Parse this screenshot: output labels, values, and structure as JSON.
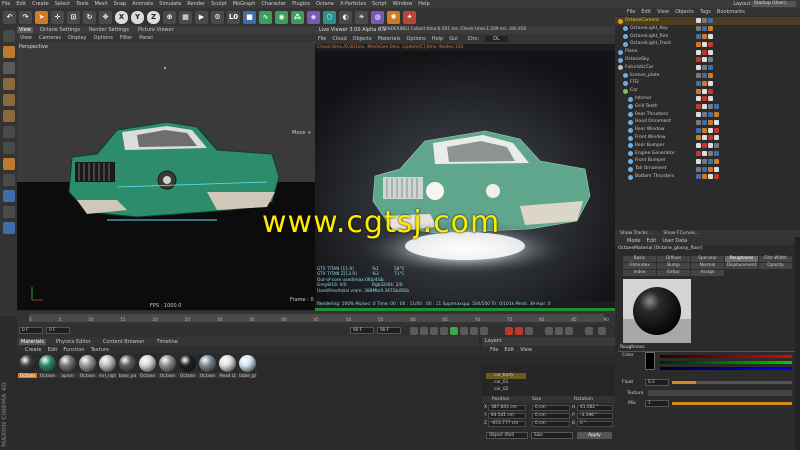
{
  "menubar": {
    "items": [
      "File",
      "Edit",
      "Create",
      "Select",
      "Tools",
      "Mesh",
      "Snap",
      "Animate",
      "Simulate",
      "Render",
      "Sculpt",
      "MoGraph",
      "Character",
      "Plugins",
      "Octane",
      "X-Particles",
      "Script",
      "Window",
      "Help"
    ],
    "layout_label": "Layout:",
    "layout_value": "Startup (User)"
  },
  "toolbar": {
    "axis_x": "X",
    "axis_y": "Y",
    "axis_z": "Z",
    "coord_l": "L0"
  },
  "viewport1": {
    "tabs": [
      "View",
      "Octane Settings",
      "Render Settings",
      "Picture Viewer"
    ],
    "menu": [
      "View",
      "Cameras",
      "Display",
      "Options",
      "Filter",
      "Panel"
    ],
    "camera_label": "Perspective",
    "fps_label": "FPS : 1000.0",
    "frame_label": "Frame : 0",
    "move_label": "Move ✛"
  },
  "viewport2": {
    "title": "Live Viewer 3.00 Alpha 6.1",
    "menu": [
      "File",
      "Cloud",
      "Objects",
      "Materials",
      "Options",
      "Help",
      "Gui"
    ],
    "status_render": "[RENDERING]  Collect time:0.501 ms.  Check time:1.209 ms.  chk:450",
    "chn_label": "Chn:",
    "chn_value": "DL",
    "status_line": "Check:0ms./0.001ms. MeshGen:0ms. Update[C]:0ms. Nodes:156",
    "stats": [
      [
        "GTX TITAN [11.9]",
        "%1",
        "58°C"
      ],
      [
        "GTX TITAN Z[13.9]",
        "%2",
        "71°C"
      ],
      [
        "Out-of-core used/max:0Kb/4Gb",
        "",
        ""
      ],
      [
        "Grey8/16: 0/0",
        "Rgb32/64: 2/0",
        ""
      ],
      [
        "Used/free/total vram: 388Mb/4.347Gb/6Gb",
        "",
        ""
      ]
    ],
    "bottom": "Rendering: 100%   Ms/sec: 0   Time: 00 : 00 : 11/00 : 00 : 11   Spp/maxspp: 500/500   Tri: 0/101k   Mesh: 39   Hair: 0"
  },
  "timeline": {
    "ticks": [
      "0",
      "5",
      "10",
      "15",
      "20",
      "25",
      "30",
      "35",
      "40",
      "45",
      "50",
      "55",
      "60",
      "65",
      "70",
      "75",
      "80",
      "85",
      "90"
    ],
    "start_field": "0 F",
    "start_field2": "0 F",
    "end_field": "90 F",
    "end_field2": "90 F"
  },
  "materials": {
    "tabs": [
      "Materials",
      "Physics Editor",
      "Content Browser",
      "Timeline"
    ],
    "menu": [
      "Create",
      "Edit",
      "Function",
      "Texture"
    ],
    "items": [
      {
        "label": "Octane",
        "color": "#3b3b3b",
        "selected": true
      },
      {
        "label": "Octane",
        "color": "#2b8a6a",
        "selected": false
      },
      {
        "label": "apron",
        "color": "#777777",
        "selected": false
      },
      {
        "label": "Octane",
        "color": "#9a9a9a",
        "selected": false
      },
      {
        "label": "mrl_righ",
        "color": "#bdbdbd",
        "selected": false
      },
      {
        "label": "base_pa",
        "color": "#5e5e5e",
        "selected": false
      },
      {
        "label": "Octane",
        "color": "#d8d8d8",
        "selected": false
      },
      {
        "label": "Octane",
        "color": "#8f8f8f",
        "selected": false
      },
      {
        "label": "Octane",
        "color": "#1f1f1f",
        "selected": false
      },
      {
        "label": "Octane",
        "color": "#7f8b95",
        "selected": false
      },
      {
        "label": "Head Lt",
        "color": "#e0e0e0",
        "selected": false
      },
      {
        "label": "table_gl",
        "color": "#cfe6f0",
        "selected": false
      }
    ]
  },
  "layers": {
    "title": "Layers",
    "menu": [
      "File",
      "Edit",
      "View"
    ],
    "rows": [
      "car_body",
      "car_01",
      "car_02"
    ]
  },
  "coordinates": {
    "headers": [
      "Position",
      "Size",
      "Rotation"
    ],
    "rows": [
      {
        "axis": "X",
        "pos": "387.643 cm",
        "size": "0 cm",
        "rot_axis": "H",
        "rot": "41.562 °"
      },
      {
        "axis": "Y",
        "pos": "84.541 cm",
        "size": "0 cm",
        "rot_axis": "P",
        "rot": "-3.196 °"
      },
      {
        "axis": "Z",
        "pos": "-653.777 cm",
        "size": "0 cm",
        "rot_axis": "B",
        "rot": "0 °"
      }
    ],
    "mode_select": "Object (Rel)",
    "size_select": "Size",
    "apply": "Apply"
  },
  "objects": {
    "menu": [
      "File",
      "Edit",
      "View",
      "Objects",
      "Tags",
      "Bookmarks"
    ],
    "rows": [
      {
        "name": "OctaneCamera",
        "indent": 0,
        "color": "#e0a020",
        "highlight": true
      },
      {
        "name": "OctaneLight_Key",
        "indent": 1,
        "color": "#6fb0e0",
        "highlight": false
      },
      {
        "name": "OctaneLight_Rim",
        "indent": 1,
        "color": "#6fb0e0",
        "highlight": false
      },
      {
        "name": "OctaneLight_Front",
        "indent": 1,
        "color": "#6fb0e0",
        "highlight": false
      },
      {
        "name": "Plane",
        "indent": 0,
        "color": "#6fb0e0",
        "highlight": false
      },
      {
        "name": "OctaneSky",
        "indent": 0,
        "color": "#6fb0e0",
        "highlight": false
      },
      {
        "name": "FuturisticCar",
        "indent": 0,
        "color": "#c0c0c0",
        "highlight": false
      },
      {
        "name": "license_plate",
        "indent": 1,
        "color": "#6fb0e0",
        "highlight": false
      },
      {
        "name": "FFD",
        "indent": 1,
        "color": "#6fb0e0",
        "highlight": false
      },
      {
        "name": "Car",
        "indent": 1,
        "color": "#7cc060",
        "highlight": false
      },
      {
        "name": "Interior",
        "indent": 2,
        "color": "#6fb0e0",
        "highlight": false
      },
      {
        "name": "Grill Teeth",
        "indent": 2,
        "color": "#6fb0e0",
        "highlight": false
      },
      {
        "name": "Rear Thrusters",
        "indent": 2,
        "color": "#6fb0e0",
        "highlight": false
      },
      {
        "name": "Hood Ornament",
        "indent": 2,
        "color": "#6fb0e0",
        "highlight": false
      },
      {
        "name": "Rear Window",
        "indent": 2,
        "color": "#6fb0e0",
        "highlight": false
      },
      {
        "name": "Front Window",
        "indent": 2,
        "color": "#6fb0e0",
        "highlight": false
      },
      {
        "name": "Rear Bumper",
        "indent": 2,
        "color": "#6fb0e0",
        "highlight": false
      },
      {
        "name": "Engine Generator",
        "indent": 2,
        "color": "#6fb0e0",
        "highlight": false
      },
      {
        "name": "Front Bumper",
        "indent": 2,
        "color": "#6fb0e0",
        "highlight": false
      },
      {
        "name": "Tail Ornament",
        "indent": 2,
        "color": "#6fb0e0",
        "highlight": false
      },
      {
        "name": "Bottom Thrusters",
        "indent": 2,
        "color": "#6fb0e0",
        "highlight": false
      }
    ],
    "tabs": [
      "Show Tracks ...",
      "Show FCurves..."
    ]
  },
  "attributes": {
    "menu": [
      "Mode",
      "Edit",
      "User Data"
    ],
    "title": "OctaneMaterial [Octane_glossy_floor]",
    "tabs_row1": [
      "Basic",
      "Diffuse",
      "Specular",
      "Roughness",
      "Film Width"
    ],
    "tabs_row2": [
      "Filmindex",
      "Bump",
      "Normal",
      "Displacement",
      "Opacity"
    ],
    "tabs_row3": [
      "Index",
      "Editor",
      "Assign"
    ],
    "active_tab": "Roughness",
    "section": "Roughness",
    "color_label": "Color",
    "float_label": "Float",
    "float_value": "0.2",
    "texture_label": "Texture",
    "mix_label": "Mix",
    "mix_value": "1"
  },
  "watermark": "www.cgtsj.com",
  "logo_text": "MAXON CINEMA 4D"
}
